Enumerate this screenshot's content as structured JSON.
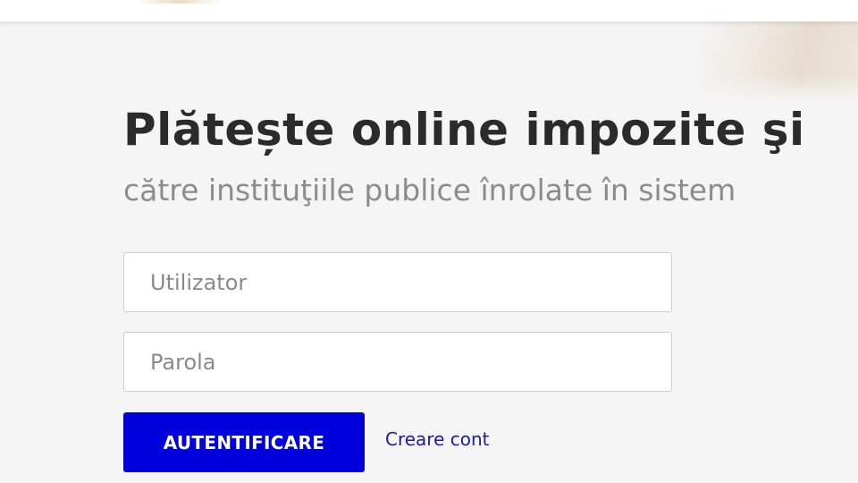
{
  "hero": {
    "title": "Plătește online impozite şi",
    "subtitle": "către instituţiile publice înrolate în sistem"
  },
  "login_form": {
    "username_placeholder": "Utilizator",
    "password_placeholder": "Parola",
    "submit_label": "AUTENTIFICARE",
    "create_account_label": "Creare cont"
  },
  "colors": {
    "page_background": "#f5f5f5",
    "title_text": "#2b2b2b",
    "subtitle_text": "#8c8c8c",
    "button_background": "#0000dc",
    "link_text": "#1a1aa6"
  }
}
